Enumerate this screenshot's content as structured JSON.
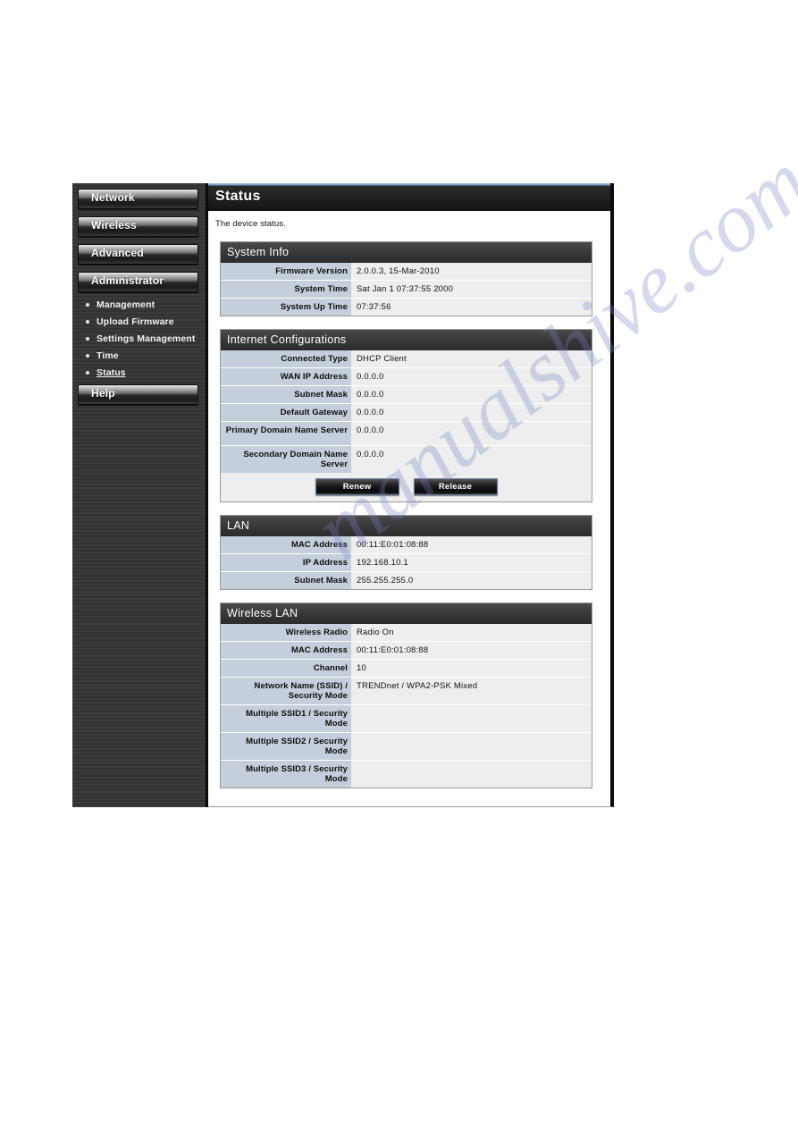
{
  "page": {
    "title": "Status",
    "intro": "The device status."
  },
  "sidebar": {
    "buttons": [
      {
        "label": "Network"
      },
      {
        "label": "Wireless"
      },
      {
        "label": "Advanced"
      },
      {
        "label": "Administrator"
      }
    ],
    "submenu": [
      {
        "label": "Management",
        "active": false
      },
      {
        "label": "Upload Firmware",
        "active": false
      },
      {
        "label": "Settings Management",
        "active": false
      },
      {
        "label": "Time",
        "active": false
      },
      {
        "label": "Status",
        "active": true
      }
    ],
    "help_button": {
      "label": "Help"
    }
  },
  "sections": {
    "system_info": {
      "heading": "System Info",
      "rows": [
        {
          "label": "Firmware Version",
          "value": "2.0.0.3, 15-Mar-2010"
        },
        {
          "label": "System Time",
          "value": "Sat Jan 1 07:37:55 2000"
        },
        {
          "label": "System Up Time",
          "value": "07:37:56"
        }
      ]
    },
    "internet_configurations": {
      "heading": "Internet Configurations",
      "rows": [
        {
          "label": "Connected Type",
          "value": "DHCP Client"
        },
        {
          "label": "WAN IP Address",
          "value": "0.0.0.0"
        },
        {
          "label": "Subnet Mask",
          "value": "0.0.0.0"
        },
        {
          "label": "Default Gateway",
          "value": "0.0.0.0"
        },
        {
          "label": "Primary Domain Name Server",
          "value": "0.0.0.0"
        },
        {
          "label": "Secondary Domain Name Server",
          "value": "0.0.0.0"
        }
      ],
      "buttons": [
        {
          "label": "Renew"
        },
        {
          "label": "Release"
        }
      ]
    },
    "lan": {
      "heading": "LAN",
      "rows": [
        {
          "label": "MAC Address",
          "value": "00:11:E0:01:08:88"
        },
        {
          "label": "IP Address",
          "value": "192.168.10.1"
        },
        {
          "label": "Subnet Mask",
          "value": "255.255.255.0"
        }
      ]
    },
    "wireless_lan": {
      "heading": "Wireless LAN",
      "rows": [
        {
          "label": "Wireless Radio",
          "value": "Radio On"
        },
        {
          "label": "MAC Address",
          "value": "00:11:E0:01:08:88"
        },
        {
          "label": "Channel",
          "value": "10"
        },
        {
          "label": "Network Name (SSID) / Security Mode",
          "value": "TRENDnet / WPA2-PSK Mixed"
        },
        {
          "label": "Multiple SSID1 / Security Mode",
          "value": ""
        },
        {
          "label": "Multiple SSID2 / Security Mode",
          "value": ""
        },
        {
          "label": "Multiple SSID3 / Security Mode",
          "value": ""
        }
      ]
    }
  },
  "watermark": {
    "text": "manualshive.com"
  },
  "colors": {
    "label_cell": "#c5cfdb",
    "value_cell": "#eeeeee",
    "section_header": "#3a3a3a",
    "sidebar": "#353535",
    "title_accent": "#7f9ad0"
  }
}
